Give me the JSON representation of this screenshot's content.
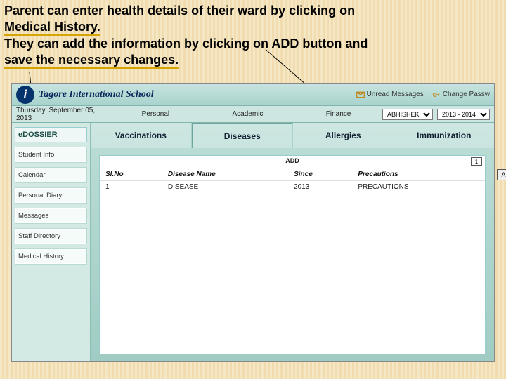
{
  "instruction": {
    "line1a": "Parent can enter health details of their ward by clicking on",
    "line1b": " Medical History.",
    "line2a": "They can add the information by clicking on ADD button and",
    "line2b": "save the necessary changes."
  },
  "titlebar": {
    "school_name": "Tagore International School",
    "links": {
      "unread": "Unread Messages",
      "change_pw": "Change Passw"
    }
  },
  "menubar": {
    "date": "Thursday, September 05, 2013",
    "items": [
      "Personal",
      "Academic",
      "Finance"
    ],
    "student": "ABHISHEK",
    "session": "2013 - 2014"
  },
  "sidebar": {
    "heading": "eDOSSIER",
    "items": [
      "Student Info",
      "Calendar",
      "Personal Diary",
      "Messages",
      "Staff Directory",
      "Medical History"
    ]
  },
  "tabs": [
    "Vaccinations",
    "Diseases",
    "Allergies",
    "Immunization"
  ],
  "grid": {
    "add_label": "ADD",
    "count": "1",
    "headers": {
      "sl": "Sl.No",
      "name": "Disease Name",
      "since": "Since",
      "prec": "Precautions"
    },
    "row": {
      "sl": "1",
      "name": "DISEASE",
      "since": "2013",
      "prec": "PRECAUTIONS"
    }
  },
  "buttons": {
    "add": "ADD"
  }
}
